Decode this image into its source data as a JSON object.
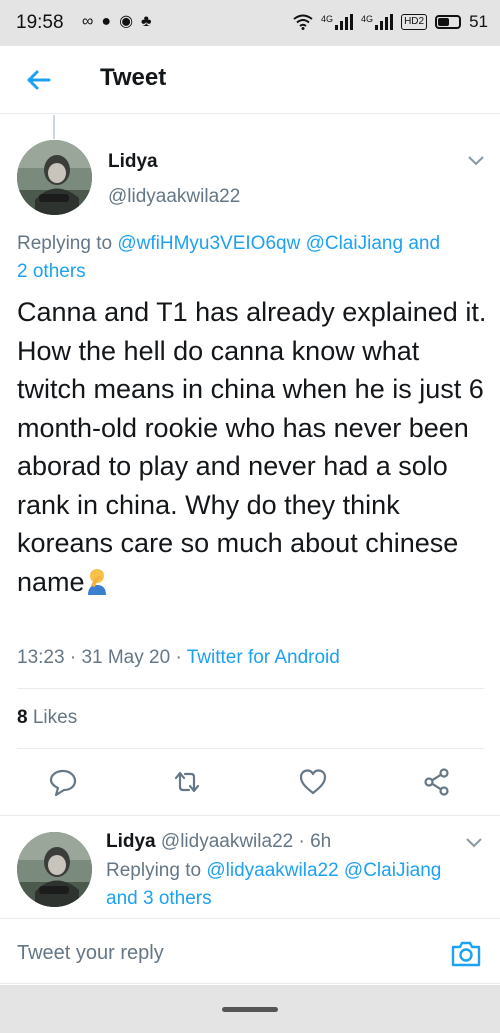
{
  "status_bar": {
    "time": "19:58",
    "network_1": "4G",
    "network_2": "4G",
    "hd": "HD2",
    "battery": "51"
  },
  "header": {
    "title": "Tweet"
  },
  "main_tweet": {
    "name": "Lidya",
    "handle": "@lidyaakwila22",
    "replying_prefix": "Replying to",
    "mention_1": "@wfiHMyu3VEIO6qw",
    "mention_2": "@ClaiJiang",
    "and_word": "and",
    "others": "2 others",
    "text": "Canna and T1 has already explained it. How the hell do canna know what twitch means in china when he is just 6 month-old rookie who has never been aborad to play and never had a solo rank in china. Why do they think koreans care so much about chinese name",
    "time": "13:23",
    "date": "31 May 20",
    "source": "Twitter for Android",
    "likes_count": "8",
    "likes_label": "Likes"
  },
  "reply_tweet": {
    "name": "Lidya",
    "handle": "@lidyaakwila22",
    "age": "6h",
    "replying_prefix": "Replying to",
    "mention_1": "@lidyaakwila22",
    "mention_2": "@ClaiJiang",
    "others_link": "and 3 others"
  },
  "compose": {
    "placeholder": "Tweet your reply"
  },
  "icons": {
    "back": "arrow-left-icon",
    "caret": "chevron-down-icon",
    "reply": "reply-icon",
    "retweet": "retweet-icon",
    "like": "heart-icon",
    "share": "share-icon",
    "camera": "camera-icon",
    "emoji": "facepalm-emoji"
  },
  "colors": {
    "accent": "#1da1f2",
    "secondary_text": "#657786",
    "primary_text": "#14171a"
  }
}
